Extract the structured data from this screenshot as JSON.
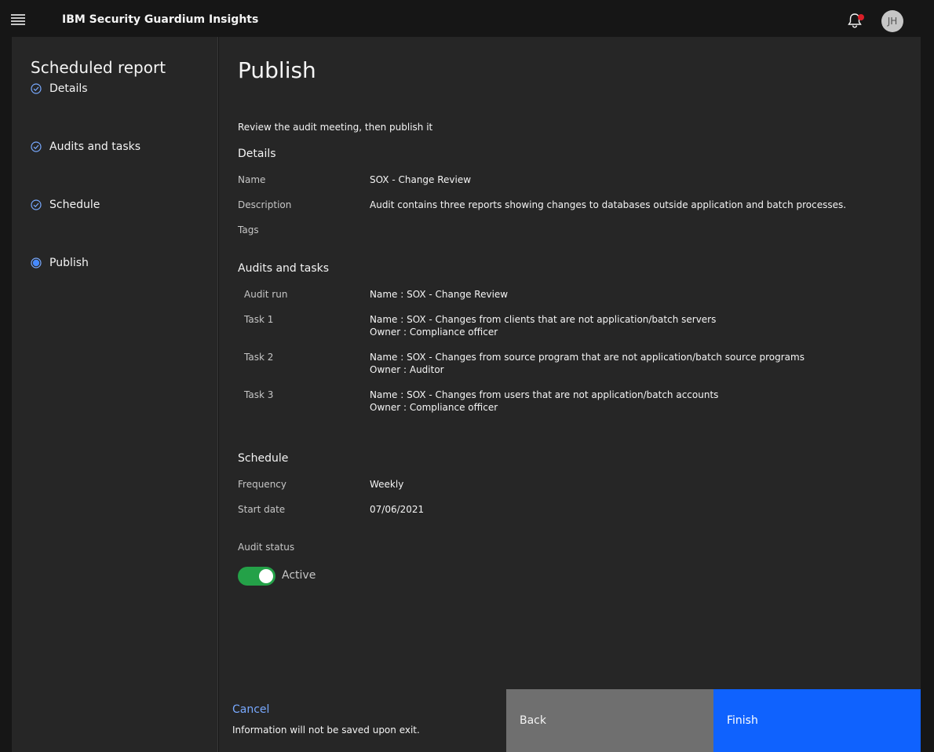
{
  "header": {
    "app_title": "IBM Security Guardium Insights",
    "menu_icon": "hamburger-menu-icon",
    "notification_icon": "bell-icon",
    "avatar_initials": "JH"
  },
  "sidebar": {
    "title": "Scheduled report",
    "steps": [
      {
        "label": "Details",
        "state": "complete",
        "icon": "checkmark-outline-icon"
      },
      {
        "label": "Audits and tasks",
        "state": "complete",
        "icon": "checkmark-outline-icon"
      },
      {
        "label": "Schedule",
        "state": "complete",
        "icon": "checkmark-outline-icon"
      },
      {
        "label": "Publish",
        "state": "current",
        "icon": "radio-current-icon"
      }
    ]
  },
  "main": {
    "title": "Publish",
    "intro": "Review the audit meeting, then publish it",
    "details": {
      "heading": "Details",
      "name_label": "Name",
      "name_value": "SOX - Change Review",
      "description_label": "Description",
      "description_value": "Audit contains three reports showing changes to databases outside application and batch processes.",
      "tags_label": "Tags"
    },
    "audits": {
      "heading": "Audits and tasks",
      "rows": [
        {
          "label": "Audit run",
          "line1": "Name : SOX - Change Review",
          "line2": ""
        },
        {
          "label": "Task 1",
          "line1": "Name : SOX - Changes from clients that are not application/batch servers",
          "line2": "Owner : Compliance officer"
        },
        {
          "label": "Task 2",
          "line1": "Name : SOX - Changes from source program that are not application/batch source programs",
          "line2": "Owner : Auditor"
        },
        {
          "label": "Task 3",
          "line1": "Name : SOX - Changes from users that are not application/batch accounts",
          "line2": "Owner : Compliance officer"
        }
      ]
    },
    "schedule": {
      "heading": "Schedule",
      "frequency_label": "Frequency",
      "frequency_value": "Weekly",
      "start_label": "Start date",
      "start_value": "07/06/2021"
    },
    "status": {
      "label": "Audit status",
      "toggle_text": "Active",
      "toggle_on": true
    }
  },
  "footer": {
    "cancel_label": "Cancel",
    "note": "Information will not be saved upon exit.",
    "back_label": "Back",
    "finish_label": "Finish"
  },
  "colors": {
    "background": "#161616",
    "panel": "#262626",
    "accent": "#0f62fe",
    "link": "#78a9ff",
    "success": "#24a148",
    "secondary_button": "#6f6f6f",
    "notification_dot": "#da1e28"
  }
}
